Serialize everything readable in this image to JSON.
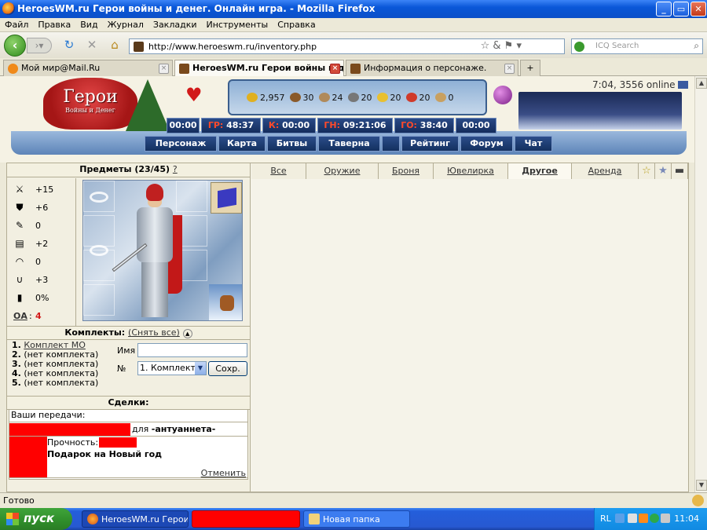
{
  "window": {
    "title": "HeroesWM.ru Герои войны и денег. Онлайн игра. - Mozilla Firefox",
    "buttons": [
      "_",
      "▭",
      "✕"
    ]
  },
  "menu": [
    "Файл",
    "Правка",
    "Вид",
    "Журнал",
    "Закладки",
    "Инструменты",
    "Справка"
  ],
  "toolbar": {
    "url": "http://www.heroeswm.ru/inventory.php",
    "search_placeholder": "ICQ Search",
    "back_icon": "back-arrow-icon",
    "forward_icon": "forward-arrow-icon"
  },
  "tabs": [
    {
      "label": "Мой мир@Mail.Ru",
      "active": false
    },
    {
      "label": "HeroesWM.ru Герои войны и ден...",
      "active": true
    },
    {
      "label": "Информация о персонаже.",
      "active": false
    }
  ],
  "game": {
    "logo_main": "Герои",
    "logo_sub": "Войны и Денег",
    "online": "7:04, 3556 online",
    "resources": [
      {
        "value": "2,957",
        "color": "#e0b020"
      },
      {
        "value": "30",
        "color": "#8a5a2a"
      },
      {
        "value": "24",
        "color": "#b08a5a"
      },
      {
        "value": "20",
        "color": "#777777"
      },
      {
        "value": "20",
        "color": "#e8c030"
      },
      {
        "value": "20",
        "color": "#d03a2a"
      },
      {
        "value": "0",
        "color": "#c8a060"
      }
    ],
    "timers": [
      {
        "label": "",
        "value": "00:00"
      },
      {
        "label": "ГР:",
        "value": "48:37"
      },
      {
        "label": "К:",
        "value": "00:00"
      },
      {
        "label": "ГН:",
        "value": "09:21:06"
      },
      {
        "label": "ГО:",
        "value": "38:40"
      },
      {
        "label": "",
        "value": "00:00"
      }
    ],
    "nav": [
      "Персонаж",
      "Карта",
      "Битвы",
      "Таверна",
      "",
      "Рейтинг",
      "Форум",
      "Чат"
    ]
  },
  "inventory": {
    "header_label": "Предметы (23/45)",
    "header_help": "?",
    "stats": [
      {
        "icon": "sword-icon",
        "glyph": "⚔",
        "value": "+15"
      },
      {
        "icon": "shield-icon",
        "glyph": "⛊",
        "value": "+6"
      },
      {
        "icon": "wand-icon",
        "glyph": "✎",
        "value": "0"
      },
      {
        "icon": "spellbook-icon",
        "glyph": "▤",
        "value": "+2"
      },
      {
        "icon": "rainbow-icon",
        "glyph": "◠",
        "value": "0"
      },
      {
        "icon": "horseshoe-icon",
        "glyph": "∪",
        "value": "+3"
      },
      {
        "icon": "barrel-icon",
        "glyph": "▮",
        "value": "0%"
      }
    ],
    "oa_label": "ОА",
    "oa_value": "4",
    "sets_header": "Комплекты:",
    "sets_remove_all": "(Снять все)",
    "sets": [
      {
        "num": "1.",
        "name": "Комплект МО",
        "link": true
      },
      {
        "num": "2.",
        "name": "(нет комплекта)",
        "link": false
      },
      {
        "num": "3.",
        "name": "(нет комплекта)",
        "link": false
      },
      {
        "num": "4.",
        "name": "(нет комплекта)",
        "link": false
      },
      {
        "num": "5.",
        "name": "(нет комплекта)",
        "link": false
      }
    ],
    "name_label": "Имя",
    "name_value": "",
    "num_label": "№",
    "num_selected": "1. Комплект",
    "save_label": "Сохр.",
    "deals_header": "Сделки:",
    "deals_title": "Ваши передачи:",
    "deal_for": "для",
    "deal_recipient": "-антуаннета-",
    "deal_durability_label": "Прочность:",
    "deal_item": "Подарок на Новый год",
    "deal_cancel": "Отменить"
  },
  "categories": [
    {
      "label": "Все",
      "selected": false
    },
    {
      "label": "Оружие",
      "selected": false
    },
    {
      "label": "Броня",
      "selected": false
    },
    {
      "label": "Ювелирка",
      "selected": false
    },
    {
      "label": "Другое",
      "selected": true
    },
    {
      "label": "Аренда",
      "selected": false
    }
  ],
  "category_icons": [
    "star-outline-icon",
    "star-filled-icon",
    "chest-icon"
  ],
  "status": "Готово",
  "taskbar": {
    "start": "пуск",
    "items": [
      {
        "label": "HeroesWM.ru Герои ...",
        "icon": "firefox-icon"
      },
      {
        "label": "",
        "icon": "redacted"
      },
      {
        "label": "Новая папка",
        "icon": "folder-icon"
      }
    ],
    "lang": "RL",
    "clock": "11:04"
  }
}
